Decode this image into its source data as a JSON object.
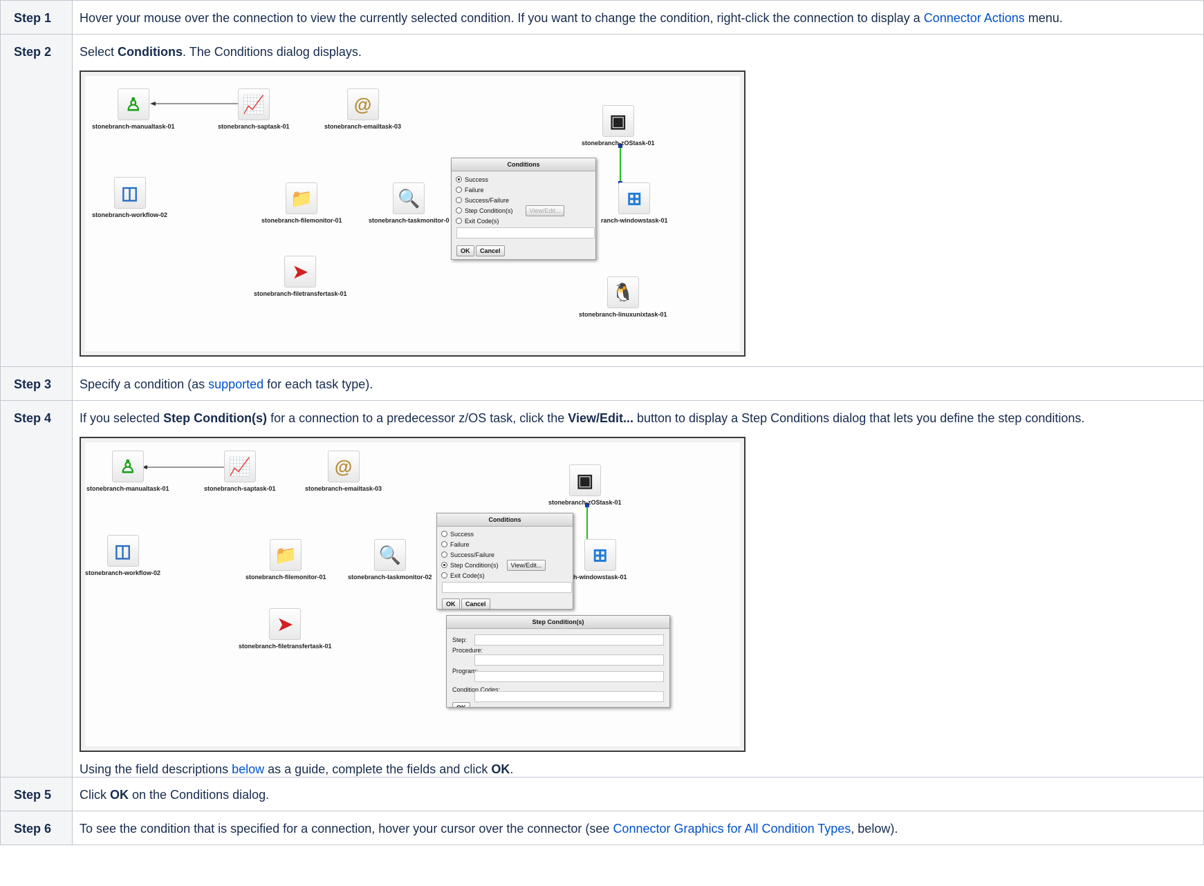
{
  "steps": [
    {
      "label": "Step 1",
      "text_before": "Hover your mouse over the connection to view the currently selected condition. If you want to change the condition, right-click the connection to display a ",
      "link": "Connector Actions",
      "text_after": " menu."
    },
    {
      "label": "Step 2",
      "text_before": "Select ",
      "bold": "Conditions",
      "text_after": ". The Conditions dialog displays."
    },
    {
      "label": "Step 3",
      "text_before": "Specify a condition (as ",
      "link": "supported",
      "text_after": " for each task type)."
    },
    {
      "label": "Step 4",
      "text_a": "If you selected ",
      "bold_a": "Step Condition(s)",
      "text_b": " for a connection to a predecessor z/OS task, click the ",
      "bold_b": "View/Edit...",
      "text_c": " button to display a Step Conditions dialog that lets you define the step conditions.",
      "after_a": "Using the field descriptions ",
      "after_link": "below",
      "after_b": " as a guide, complete the fields and click ",
      "after_bold": "OK",
      "after_c": "."
    },
    {
      "label": "Step 5",
      "text_before": "Click ",
      "bold": "OK",
      "text_after": " on the Conditions dialog."
    },
    {
      "label": "Step 6",
      "text_before": "To see the condition that is specified for a connection, hover your cursor over the connector (see ",
      "link": "Connector Graphics for All Condition Types",
      "text_after": ", below)."
    }
  ],
  "workflow": {
    "nodes": {
      "manual": "stonebranch-manualtask-01",
      "sap": "stonebranch-saptask-01",
      "email": "stonebranch-emailtask-03",
      "zos": "stonebranch-zOStask-01",
      "workflow": "stonebranch-workflow-02",
      "filemonitor": "stonebranch-filemonitor-01",
      "taskmonitor1": "stonebranch-taskmonitor-0",
      "taskmonitor2": "stonebranch-taskmonitor-02",
      "windows1": "ranch-windowstask-01",
      "windows2": "h-windowstask-01",
      "filetransfer": "stonebranch-filetransfertask-01",
      "linux": "stonebranch-linuxunixtask-01"
    },
    "icons": [
      "person-icon",
      "sap-icon",
      "email-icon",
      "server-icon",
      "workflow-icon",
      "folder-search-icon",
      "task-monitor-icon",
      "windows-icon",
      "file-transfer-icon",
      "linux-icon"
    ]
  },
  "conditions_dialog": {
    "title": "Conditions",
    "options": [
      "Success",
      "Failure",
      "Success/Failure",
      "Step Condition(s)",
      "Exit Code(s)"
    ],
    "view_edit": "View/Edit...",
    "ok": "OK",
    "cancel": "Cancel"
  },
  "step_conditions_dialog": {
    "title": "Step Condition(s)",
    "fields": [
      "Step:",
      "Procedure:",
      "Program:",
      "Condition Codes:"
    ],
    "ok": "OK"
  },
  "colors": {
    "link": "#0052cc",
    "label_bg": "#f4f5f7",
    "border": "#c1c7d0",
    "connector_green": "#22bb22",
    "connector_blue": "#1a3aa8"
  }
}
